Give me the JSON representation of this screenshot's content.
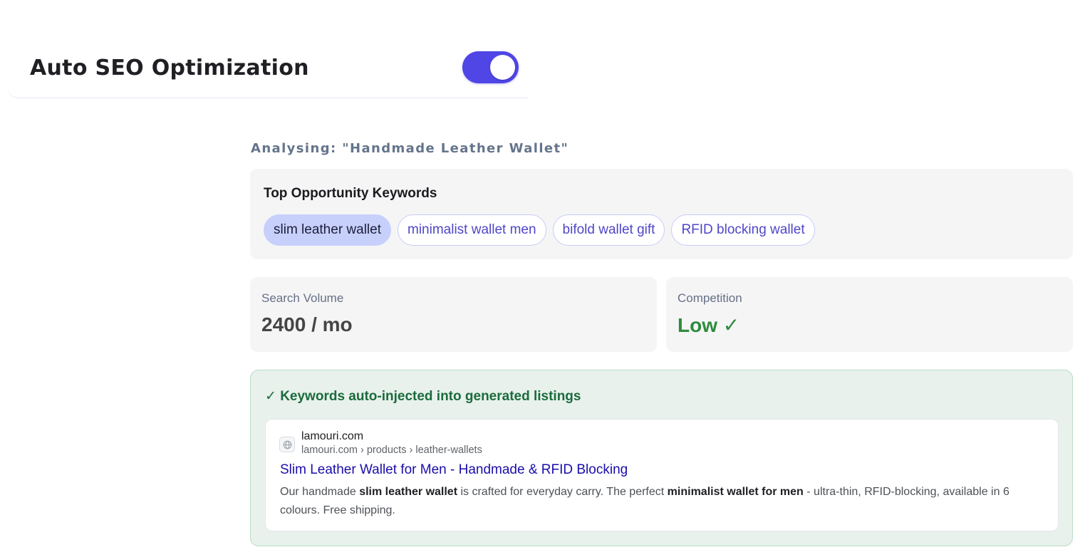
{
  "seo": {
    "title": "Auto SEO Optimization",
    "toggle_on": true
  },
  "analysis": {
    "label": "Analysing: \"Handmade Leather Wallet\""
  },
  "keywords": {
    "title": "Top Opportunity Keywords",
    "chips": [
      {
        "label": "slim leather wallet",
        "active": true
      },
      {
        "label": "minimalist wallet men",
        "active": false
      },
      {
        "label": "bifold wallet gift",
        "active": false
      },
      {
        "label": "RFID blocking wallet",
        "active": false
      }
    ]
  },
  "metrics": {
    "volume_label": "Search Volume",
    "volume_value": "2400 / mo",
    "competition_label": "Competition",
    "competition_value": "Low ✓"
  },
  "inject": {
    "title": "✓ Keywords auto-injected into generated listings",
    "serp": {
      "favicon": "globe-icon",
      "domain": "lamouri.com",
      "path": "lamouri.com › products › leather-wallets",
      "title": "Slim Leather Wallet for Men - Handmade & RFID Blocking",
      "desc_1": "Our handmade ",
      "desc_kw_1": "slim leather wallet",
      "desc_2": " is crafted for everyday carry. The perfect ",
      "desc_kw_2": "minimalist wallet for men",
      "desc_3": " - ultra-thin, RFID-blocking, available in 6 colours. Free shipping."
    }
  },
  "colors": {
    "accent": "#4f46e5",
    "success": "#2e8b3d",
    "inject_bg": "#e8f1ec",
    "link": "#1a0dab"
  }
}
